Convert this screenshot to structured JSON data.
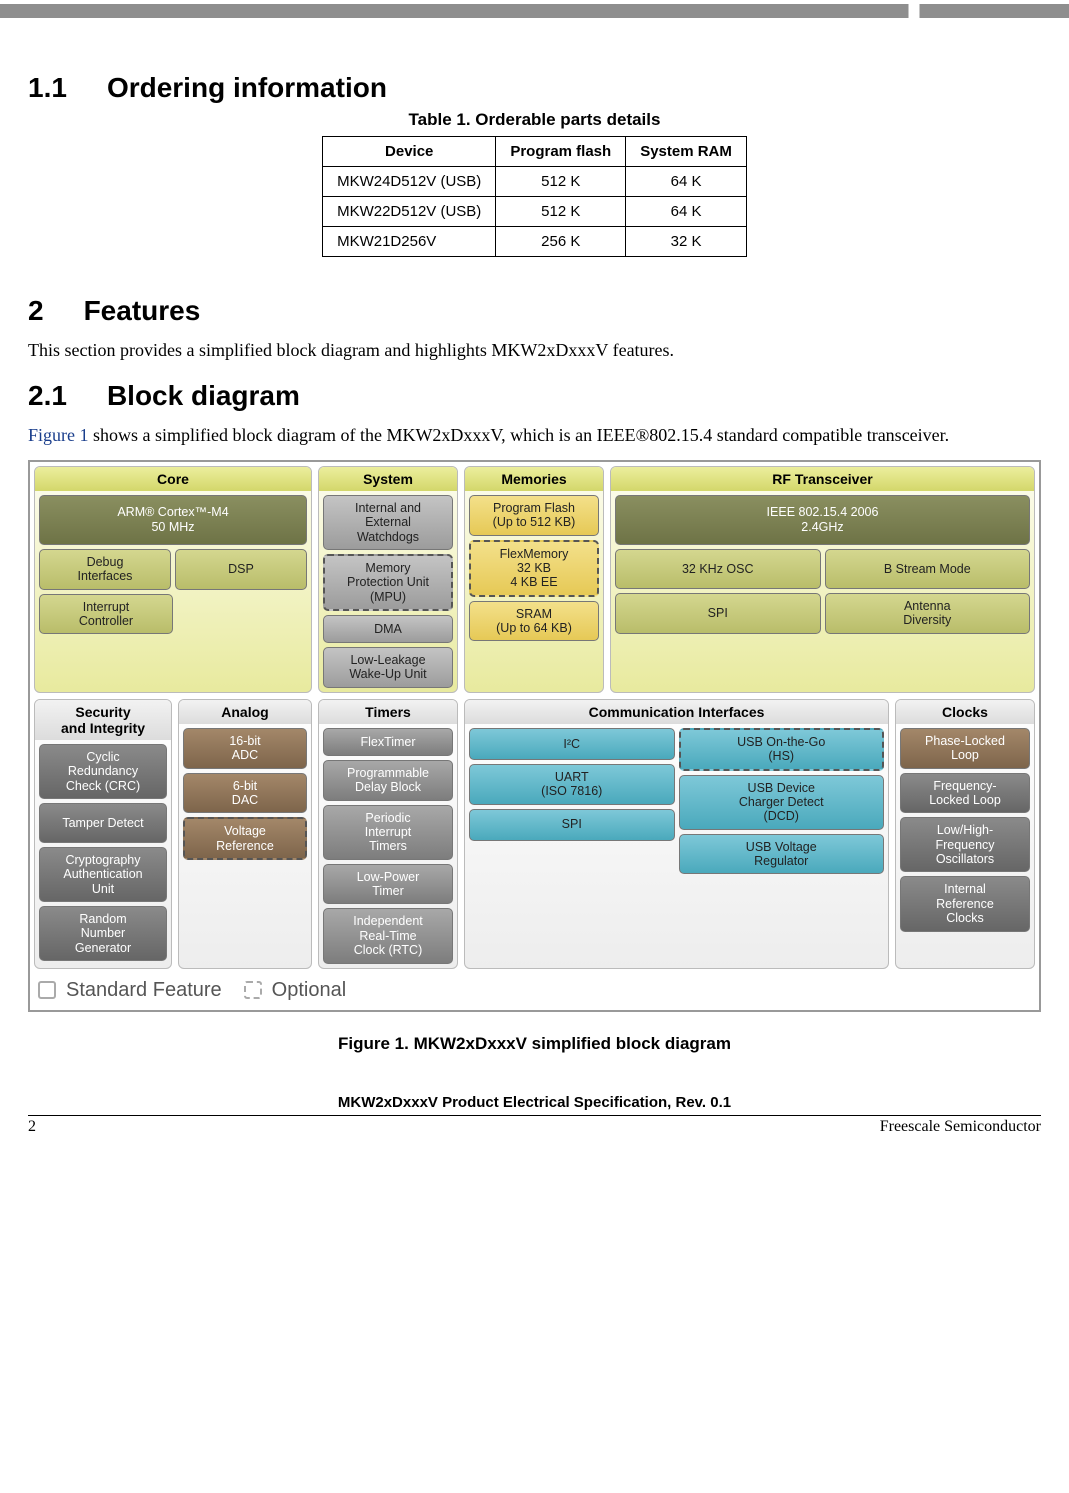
{
  "headings": {
    "s11_num": "1.1",
    "s11_title": "Ordering information",
    "s2_num": "2",
    "s2_title": "Features",
    "s21_num": "2.1",
    "s21_title": "Block diagram"
  },
  "table": {
    "caption": "Table 1. Orderable parts details",
    "headers": [
      "Device",
      "Program flash",
      "System RAM"
    ],
    "rows": [
      [
        "MKW24D512V (USB)",
        "512 K",
        "64 K"
      ],
      [
        "MKW22D512V (USB)",
        "512 K",
        "64 K"
      ],
      [
        "MKW21D256V",
        "256 K",
        "32 K"
      ]
    ]
  },
  "text": {
    "features_intro": "This section provides a simplified block diagram and highlights MKW2xDxxxV features.",
    "fig1_ref": "Figure 1",
    "block_intro_rest": " shows a simplified block diagram of the MKW2xDxxxV, which is an IEEE®802.15.4 standard compatible transceiver."
  },
  "diagram": {
    "core": {
      "title": "Core",
      "arm": "ARM® Cortex™-M4\n50 MHz",
      "debug": "Debug\nInterfaces",
      "dsp": "DSP",
      "intc": "Interrupt\nController"
    },
    "system": {
      "title": "System",
      "wdog": "Internal and\nExternal\nWatchdogs",
      "mpu": "Memory\nProtection Unit\n(MPU)",
      "dma": "DMA",
      "llwu": "Low-Leakage\nWake-Up Unit"
    },
    "memories": {
      "title": "Memories",
      "flash": "Program Flash\n(Up to 512 KB)",
      "flex": "FlexMemory\n32 KB\n4 KB EE",
      "sram": "SRAM\n(Up to 64 KB)"
    },
    "rf": {
      "title": "RF Transceiver",
      "ieee": "IEEE 802.15.4 2006\n2.4GHz",
      "osc32": "32 KHz OSC",
      "bstream": "B Stream Mode",
      "spi": "SPI",
      "antdiv": "Antenna\nDiversity"
    },
    "security": {
      "title": "Security\nand Integrity",
      "crc": "Cyclic\nRedundancy\nCheck (CRC)",
      "tamper": "Tamper Detect",
      "crypto": "Cryptography\nAuthentication\nUnit",
      "rng": "Random\nNumber\nGenerator"
    },
    "analog": {
      "title": "Analog",
      "adc": "16-bit\nADC",
      "dac": "6-bit\nDAC",
      "vref": "Voltage\nReference"
    },
    "timers": {
      "title": "Timers",
      "flex": "FlexTimer",
      "pdb": "Programmable\nDelay Block",
      "pit": "Periodic\nInterrupt\nTimers",
      "lpt": "Low-Power\nTimer",
      "rtc": "Independent\nReal-Time\nClock (RTC)"
    },
    "comm": {
      "title": "Communication Interfaces",
      "i2c": "I²C",
      "uart": "UART\n(ISO 7816)",
      "spi": "SPI",
      "usbotg": "USB On-the-Go\n(HS)",
      "dcd": "USB Device\nCharger Detect\n(DCD)",
      "usbvr": "USB Voltage\nRegulator"
    },
    "clocks": {
      "title": "Clocks",
      "pll": "Phase-Locked\nLoop",
      "fll": "Frequency-\nLocked Loop",
      "osc": "Low/High-\nFrequency\nOscillators",
      "irc": "Internal\nReference\nClocks"
    },
    "legend": {
      "std": "Standard Feature",
      "opt": "Optional"
    }
  },
  "figure_caption": "Figure 1. MKW2xDxxxV simplified block diagram",
  "footer": {
    "doc_title": "MKW2xDxxxV Product Electrical Specification, Rev. 0.1",
    "page": "2",
    "company": "Freescale Semiconductor"
  },
  "chart_data": {
    "type": "table",
    "title": "Table 1. Orderable parts details",
    "columns": [
      "Device",
      "Program flash",
      "System RAM"
    ],
    "rows": [
      {
        "Device": "MKW24D512V (USB)",
        "Program flash": "512 K",
        "System RAM": "64 K"
      },
      {
        "Device": "MKW22D512V (USB)",
        "Program flash": "512 K",
        "System RAM": "64 K"
      },
      {
        "Device": "MKW21D256V",
        "Program flash": "256 K",
        "System RAM": "32 K"
      }
    ]
  }
}
